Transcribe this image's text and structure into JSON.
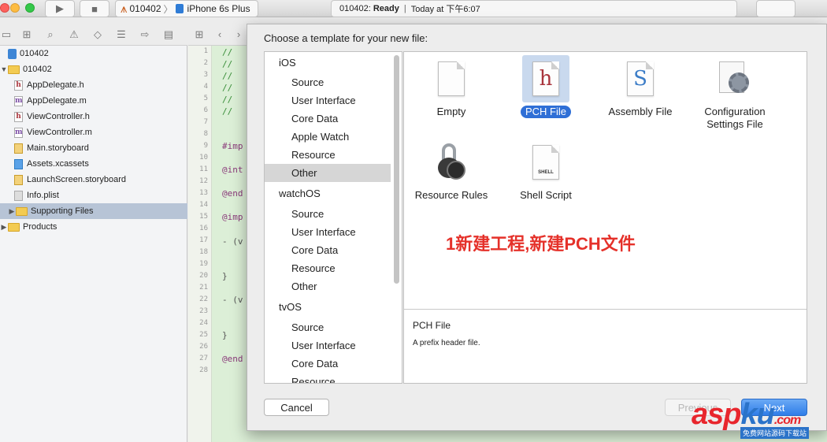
{
  "toolbar": {
    "scheme_app": "010402",
    "scheme_device": "iPhone 6s Plus",
    "status_target": "010402:",
    "status_state": "Ready",
    "status_time": "Today at 下午6:07"
  },
  "navigator": {
    "rows": [
      {
        "label": "010402",
        "kind": "project",
        "depth": 0
      },
      {
        "label": "010402",
        "kind": "folder",
        "depth": 1,
        "expanded": true
      },
      {
        "label": "AppDelegate.h",
        "kind": "h",
        "depth": 2
      },
      {
        "label": "AppDelegate.m",
        "kind": "m",
        "depth": 2
      },
      {
        "label": "ViewController.h",
        "kind": "h",
        "depth": 2
      },
      {
        "label": "ViewController.m",
        "kind": "m",
        "depth": 2
      },
      {
        "label": "Main.storyboard",
        "kind": "storyboard",
        "depth": 2
      },
      {
        "label": "Assets.xcassets",
        "kind": "xcassets",
        "depth": 2
      },
      {
        "label": "LaunchScreen.storyboard",
        "kind": "storyboard",
        "depth": 2
      },
      {
        "label": "Info.plist",
        "kind": "plist",
        "depth": 2
      },
      {
        "label": "Supporting Files",
        "kind": "folder",
        "depth": 1,
        "selected": true
      },
      {
        "label": "Products",
        "kind": "folder",
        "depth": 0
      }
    ]
  },
  "editor": {
    "line_numbers": [
      "1",
      "2",
      "3",
      "4",
      "5",
      "6",
      "7",
      "8",
      "9",
      "10",
      "11",
      "12",
      "13",
      "14",
      "15",
      "16",
      "17",
      "18",
      "19",
      "20",
      "21",
      "22",
      "23",
      "24",
      "25",
      "26",
      "27",
      "28"
    ],
    "code_lines": {
      "c1": "//",
      "c2": "//",
      "c3": "//",
      "c4": "//",
      "c5": "//",
      "c6": "//",
      "imp1": "#imp",
      "int": "@int",
      "end1": "@end",
      "imp2": "@imp",
      "m1": "- (v",
      "b1": "}",
      "m2": "- (v",
      "b2": "}",
      "end2": "@end"
    }
  },
  "sheet": {
    "title": "Choose a template for your new file:",
    "categories": [
      {
        "label": "iOS",
        "type": "head"
      },
      {
        "label": "Source",
        "type": "sub"
      },
      {
        "label": "User Interface",
        "type": "sub"
      },
      {
        "label": "Core Data",
        "type": "sub"
      },
      {
        "label": "Apple Watch",
        "type": "sub"
      },
      {
        "label": "Resource",
        "type": "sub"
      },
      {
        "label": "Other",
        "type": "sub",
        "selected": true
      },
      {
        "label": "watchOS",
        "type": "head"
      },
      {
        "label": "Source",
        "type": "sub"
      },
      {
        "label": "User Interface",
        "type": "sub"
      },
      {
        "label": "Core Data",
        "type": "sub"
      },
      {
        "label": "Resource",
        "type": "sub"
      },
      {
        "label": "Other",
        "type": "sub"
      },
      {
        "label": "tvOS",
        "type": "head"
      },
      {
        "label": "Source",
        "type": "sub"
      },
      {
        "label": "User Interface",
        "type": "sub"
      },
      {
        "label": "Core Data",
        "type": "sub"
      },
      {
        "label": "Resource",
        "type": "sub"
      }
    ],
    "templates": {
      "empty": "Empty",
      "pch": "PCH File",
      "assembly": "Assembly File",
      "config_line1": "Configuration",
      "config_line2": "Settings File",
      "resource_rules": "Resource Rules",
      "shell": "Shell Script",
      "pch_glyph": "h",
      "assembly_glyph": "S",
      "shell_tag": "SHELL"
    },
    "description": {
      "title": "PCH File",
      "text": "A prefix header file."
    },
    "buttons": {
      "cancel": "Cancel",
      "previous": "Previous",
      "next": "Next"
    }
  },
  "annotation": "1新建工程,新建PCH文件",
  "watermark": {
    "red": "asp",
    "blue": "ku",
    "suffix": ".com",
    "sub": "免费网站源码下载站"
  },
  "colors": {
    "selection_blue": "#2f6fd6",
    "annotation_red": "#e5312a",
    "editor_bg": "#dcefd7"
  }
}
